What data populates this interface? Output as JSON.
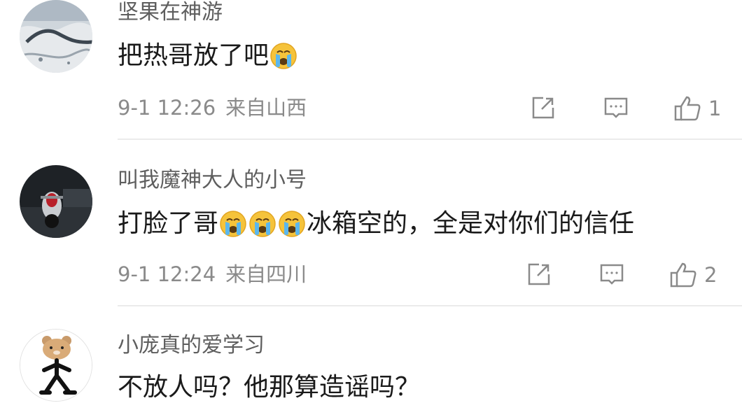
{
  "comments": [
    {
      "username": "坚果在神游",
      "text_before": "把热哥放了吧",
      "text_after": "",
      "emoji_count": 1,
      "emoji": "crying-face-icon",
      "date": "9-1 12:26",
      "location": "来自山西",
      "likes": "1"
    },
    {
      "username": "叫我魔神大人的小号",
      "text_before": "打脸了哥",
      "text_after": "冰箱空的，全是对你们的信任",
      "emoji_count": 3,
      "emoji": "crying-face-icon",
      "date": "9-1 12:24",
      "location": "来自四川",
      "likes": "2"
    },
    {
      "username": "小庞真的爱学习",
      "text_before": "不放人吗？他那算造谣吗？",
      "text_after": "",
      "emoji_count": 0,
      "date": "",
      "location": "",
      "likes": ""
    }
  ],
  "icons": {
    "share": "share-icon",
    "reply": "comment-icon",
    "like": "thumbs-up-icon"
  },
  "colors": {
    "username": "#5e5e5e",
    "text": "#1a1a1a",
    "meta": "#8a8a8a",
    "emoji": "#f5c33b",
    "divider": "#ebebeb"
  }
}
